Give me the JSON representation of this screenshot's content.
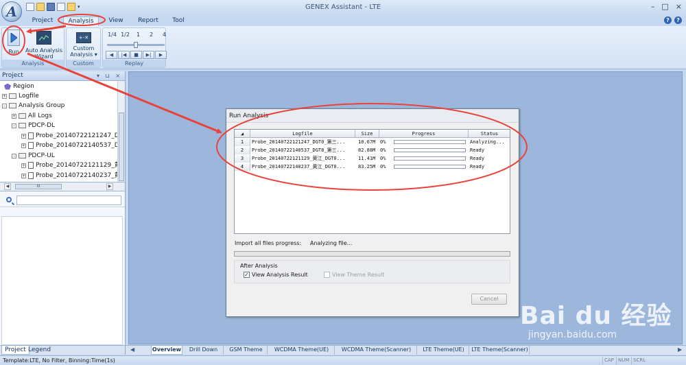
{
  "window": {
    "title": "GENEX Assistant - LTE",
    "controls": [
      "–",
      "□",
      "×"
    ],
    "help_icons": [
      "?",
      "?"
    ]
  },
  "menu": {
    "tabs": [
      "Project",
      "Analysis",
      "View",
      "Report",
      "Tool"
    ],
    "active": "Analysis"
  },
  "ribbon": {
    "analysis": {
      "run_label": "Run",
      "wizard_label_1": "Auto Analysis",
      "wizard_label_2": "Wizard",
      "group_label": "Analysis"
    },
    "custom": {
      "label_1": "Custom",
      "label_2": "Analysis ▾",
      "group_label": "Custom"
    },
    "replay": {
      "speeds": [
        "1/4",
        "1/2",
        "1",
        "2",
        "4"
      ],
      "speed_level": 0.5,
      "controls": [
        "◀",
        "|◀",
        "■",
        "▶|",
        "▶"
      ],
      "group_label": "Replay"
    }
  },
  "project_panel": {
    "title": "Project",
    "pin_icons": "▾ ⊔ ×",
    "tree": [
      {
        "label": "Region",
        "icon": "region-icon"
      },
      {
        "label": "Logfile",
        "icon": "folder-icon"
      },
      {
        "label": "Analysis Group",
        "icon": "folder-icon"
      },
      {
        "label": "All Logs",
        "icon": "folder-icon"
      },
      {
        "label": "PDCP-DL",
        "icon": "folder-icon"
      },
      {
        "label": "Probe_20140722121247_D",
        "icon": "document-icon"
      },
      {
        "label": "Probe_20140722140537_D",
        "icon": "document-icon"
      },
      {
        "label": "PDCP-UL",
        "icon": "folder-icon"
      },
      {
        "label": "Probe_20140722121129_黄",
        "icon": "document-icon"
      },
      {
        "label": "Probe_20140722140237_黄",
        "icon": "document-icon"
      }
    ],
    "scroll_thumb": "III",
    "tabs": [
      "Project",
      "Legend"
    ]
  },
  "bottom_tabs": [
    "Overview",
    "Drill Down",
    "GSM Theme",
    "WCDMA Theme(UE)",
    "WCDMA Theme(Scanner)",
    "LTE Theme(UE)",
    "LTE Theme(Scanner)"
  ],
  "bottom_nav": {
    "first": "◀",
    "last": "▶"
  },
  "statusbar": {
    "text": "Template:LTE,  No Filter,  Binning:Time(1s)",
    "indicators": [
      "CAP",
      "NUM",
      "SCRL"
    ]
  },
  "dialog": {
    "title": "Run Analysis",
    "columns": [
      "Logfile",
      "Size",
      "Progress",
      "Status"
    ],
    "rows": [
      {
        "num": "1",
        "logfile": "Probe_20140722121247_DGT0_第三...",
        "size": "10.67M",
        "progress": 0,
        "progress_text": "0%",
        "status": "Analyzing..."
      },
      {
        "num": "2",
        "logfile": "Probe_20140722140537_DGT8_第三...",
        "size": "82.88M",
        "progress": 0,
        "progress_text": "0%",
        "status": "Ready"
      },
      {
        "num": "3",
        "logfile": "Probe_20140722121129_黄江_DGT0...",
        "size": "11.41M",
        "progress": 0,
        "progress_text": "0%",
        "status": "Ready"
      },
      {
        "num": "4",
        "logfile": "Probe_20140722140237_黄江_DGT0...",
        "size": "83.25M",
        "progress": 0,
        "progress_text": "0%",
        "status": "Ready"
      }
    ],
    "import_label": "Import all files progress:",
    "import_status": "Analyzing file...",
    "import_progress": 0,
    "after_analysis": {
      "label": "After Analysis",
      "view_result": {
        "label": "View Analysis Result",
        "checked": true
      },
      "view_theme": {
        "label": "View Theme Result",
        "checked": false
      }
    },
    "cancel_label": "Cancel"
  },
  "colors": {
    "annotation": "#e8423a",
    "workspace": "#9db7dc",
    "progress": "#3fb24a"
  },
  "watermark": {
    "main": "Bai du 经验",
    "sub": "jingyan.baidu.com"
  }
}
